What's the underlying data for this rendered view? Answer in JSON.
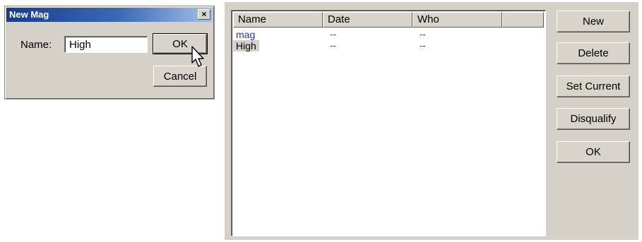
{
  "dialog": {
    "title": "New Mag",
    "close_symbol": "×",
    "name_label": "Name:",
    "name_value": "High",
    "ok_label": "OK",
    "cancel_label": "Cancel"
  },
  "list": {
    "columns": [
      "Name",
      "Date",
      "Who",
      ""
    ],
    "rows": [
      {
        "name": "mag",
        "date": "--",
        "who": "--"
      },
      {
        "name": "High",
        "date": "--",
        "who": "--"
      }
    ]
  },
  "buttons": {
    "new": "New",
    "delete": "Delete",
    "set_current": "Set Current",
    "disqualify": "Disqualify",
    "ok": "OK"
  },
  "colors": {
    "face": "#d5d0c8",
    "title_start": "#183c8a",
    "title_end": "#a7c1e6",
    "link_text": "#2a2ab0"
  },
  "icons": {
    "cursor": "mouse-pointer-icon"
  }
}
